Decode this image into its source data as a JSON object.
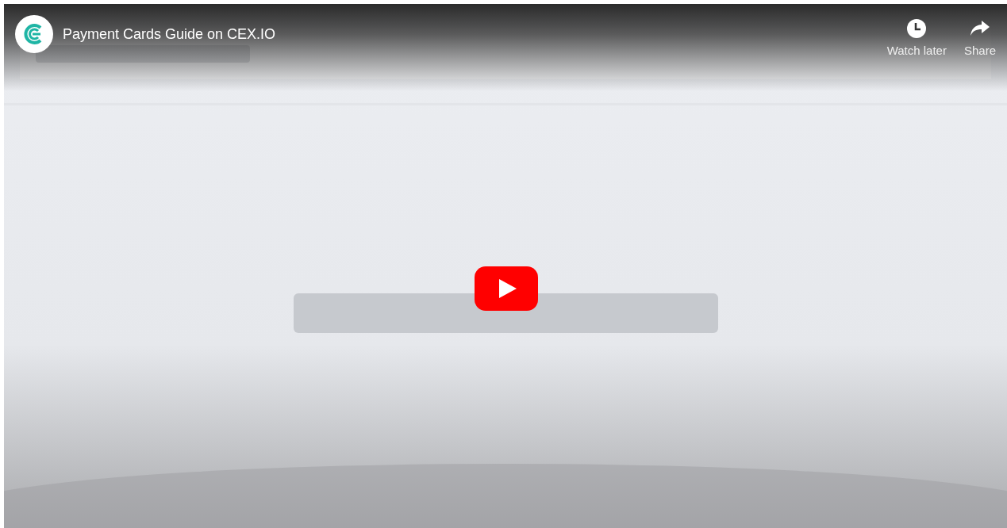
{
  "player": {
    "title": "Payment Cards Guide on CEX.IO",
    "actions": [
      {
        "kind": "watch-later",
        "label": "Watch later"
      },
      {
        "kind": "share",
        "label": "Share"
      }
    ]
  }
}
